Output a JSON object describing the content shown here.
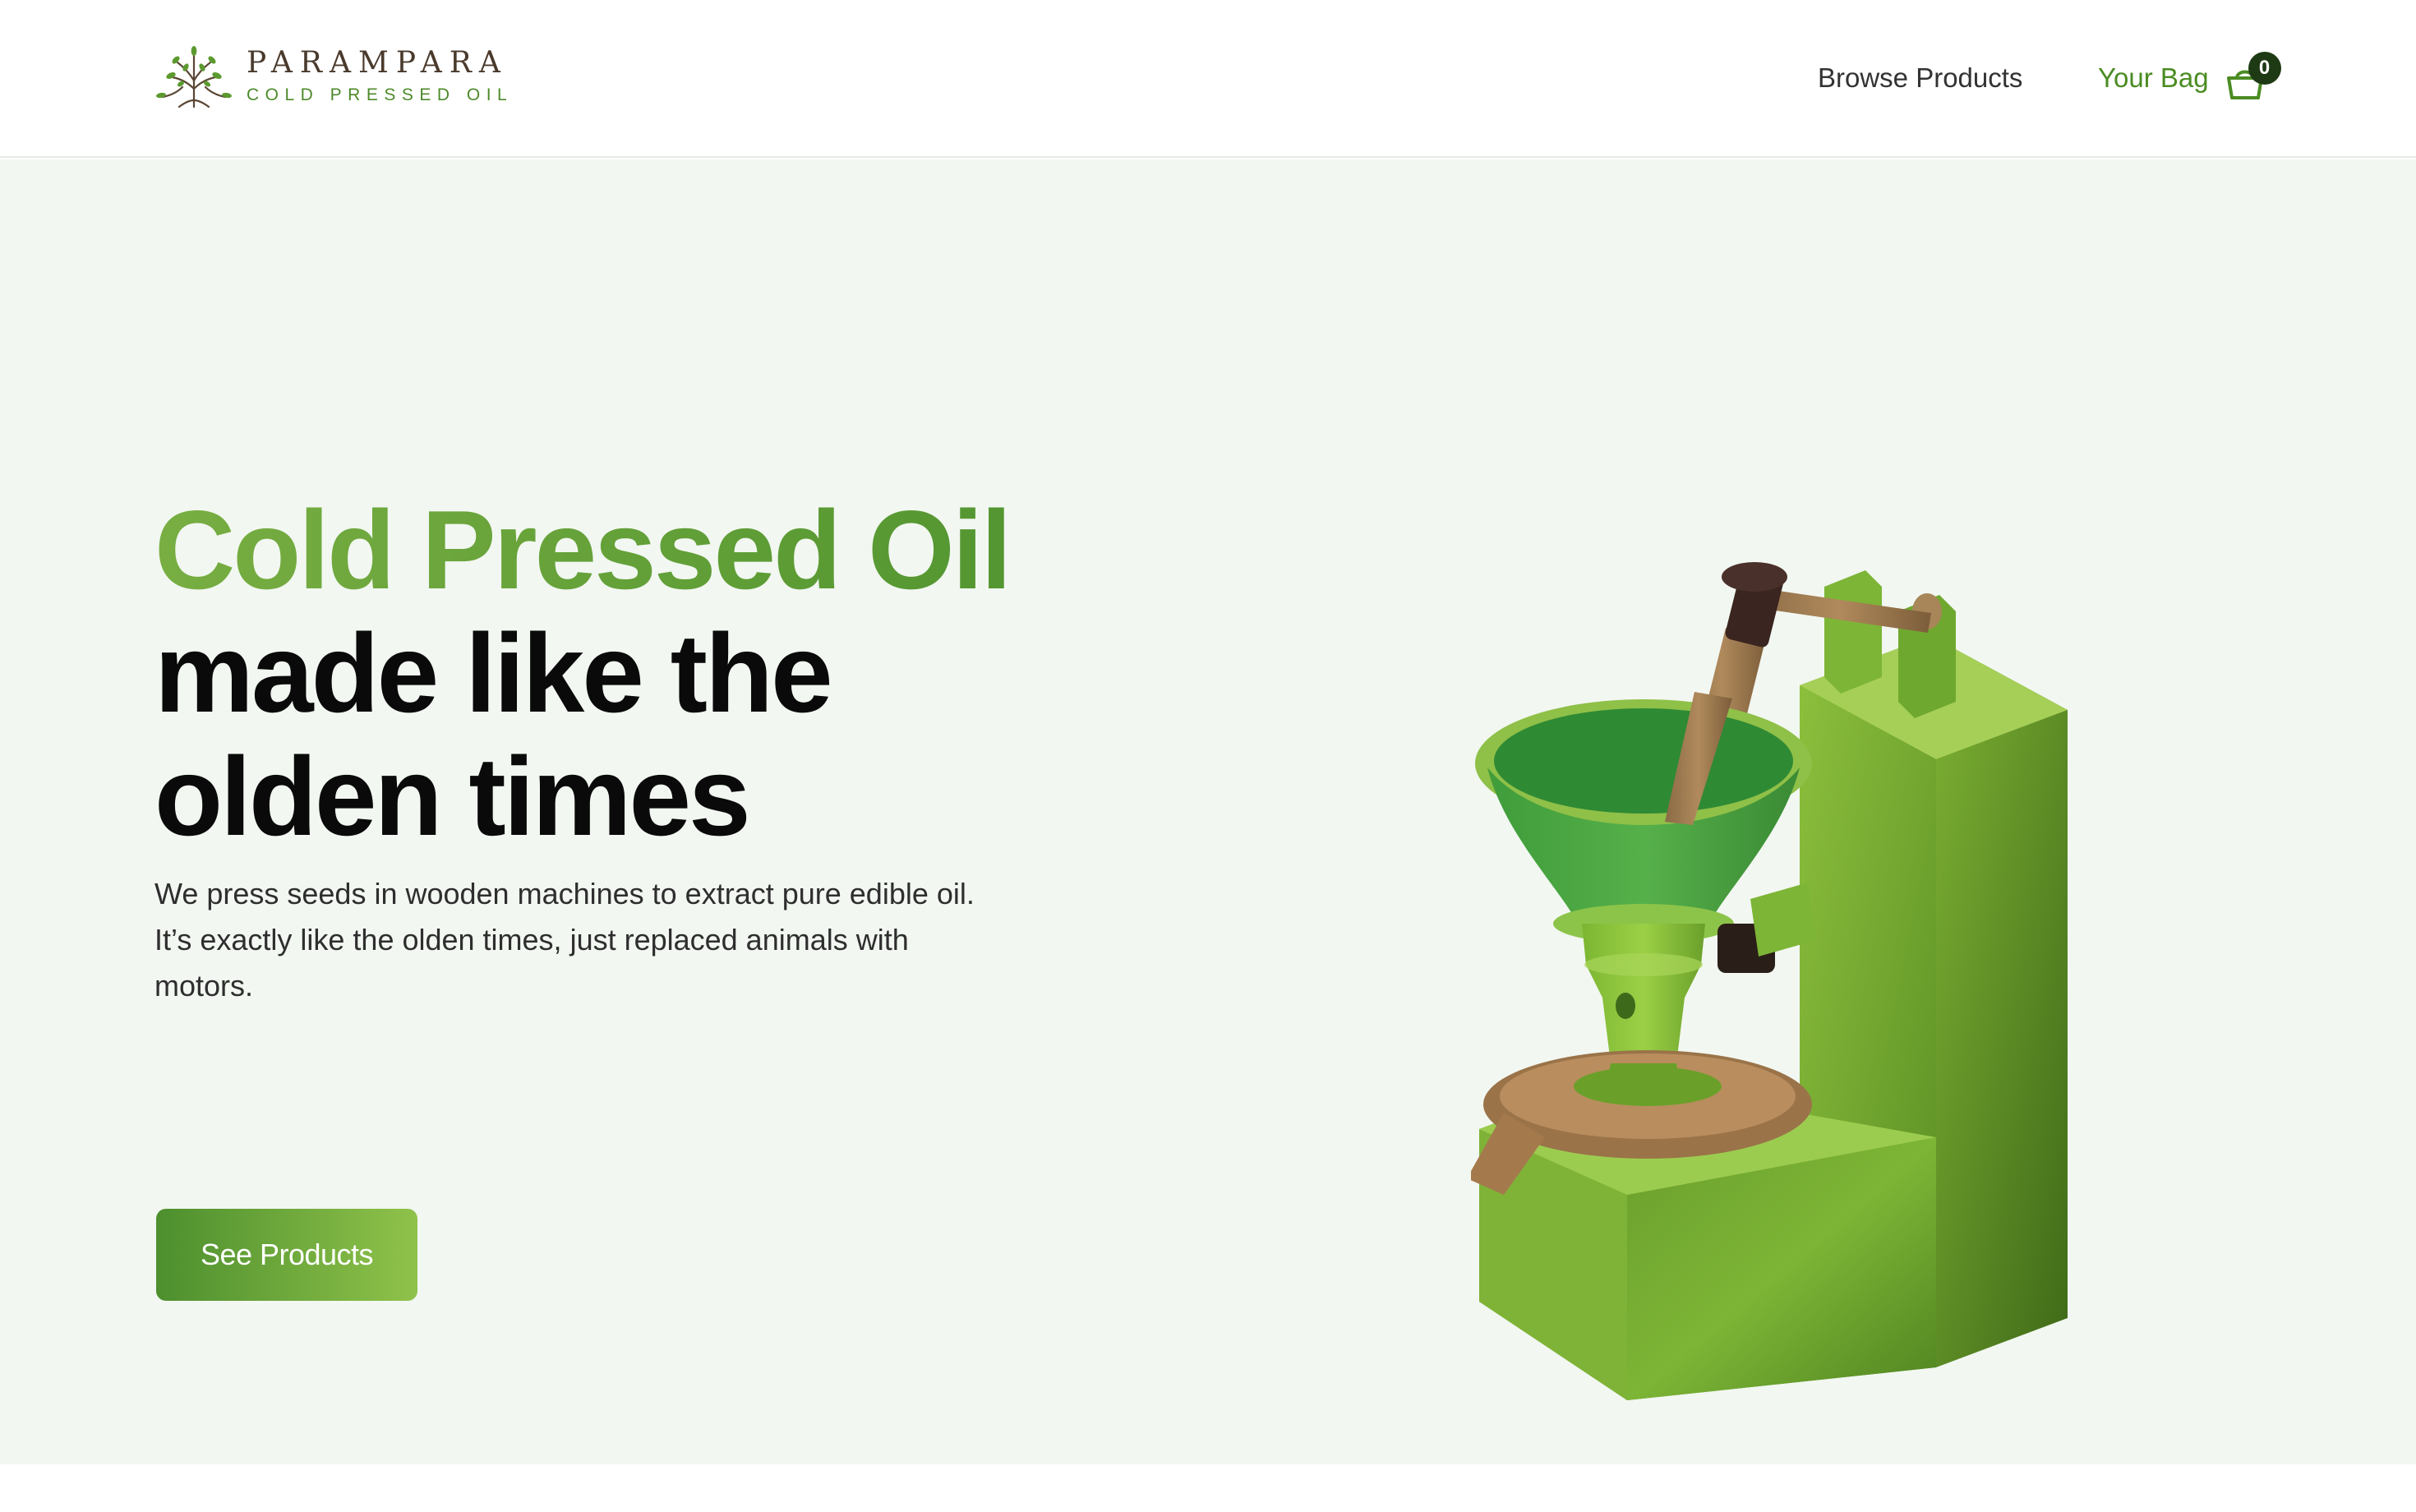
{
  "header": {
    "brand_name": "PARAMPARA",
    "brand_tagline": "COLD PRESSED OIL",
    "logo_icon": "tree-icon",
    "nav": {
      "browse_label": "Browse Products",
      "bag_label": "Your Bag",
      "bag_count": "0",
      "bag_icon": "shopping-basket-icon"
    }
  },
  "hero": {
    "headline_highlight": "Cold Pressed Oil",
    "headline_line2": "made like the",
    "headline_line3": "olden times",
    "description": "We press seeds in wooden machines to extract pure edible oil. It’s exactly like the olden times, just replaced animals with motors.",
    "cta_label": "See Products",
    "illustration": "oil-press-machine-illustration"
  },
  "colors": {
    "accent_green": "#4b8c23",
    "hero_background": "#f2f7f1",
    "badge_background": "#1e3a14"
  }
}
